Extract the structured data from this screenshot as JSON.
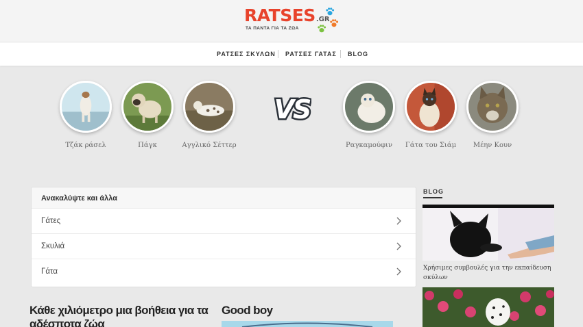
{
  "header": {
    "logo_word": "RATSES",
    "logo_tld": ".GR",
    "tagline": "ΤΑ ΠΑΝΤΑ ΓΙΑ ΤΑ ΖΩΑ",
    "paw_colors": [
      "#2aa6df",
      "#f07a28",
      "#7cc241"
    ]
  },
  "nav": {
    "items": [
      "ΡΑΤΣΕΣ ΣΚΥΛΩΝ",
      "ΡΑΤΣΕΣ ΓΑΤΑΣ",
      "BLOG"
    ]
  },
  "breeds": {
    "dogs": [
      "Τζάκ ράσελ",
      "Πάγκ",
      "Αγγλικό Σέττερ"
    ],
    "vs_label": "VS",
    "cats": [
      "Ραγκαμούφιν",
      "Γάτα του Σιάμ",
      "Μέην Κουν"
    ]
  },
  "discover": {
    "title": "Ανακαλύψτε και άλλα",
    "items": [
      "Γάτες",
      "Σκυλιά",
      "Γάτα"
    ]
  },
  "articles": {
    "help_title": "Κάθε χιλιόμετρο μια βοήθεια για τα αδέσποτα ζώα",
    "good_title": "Good boy"
  },
  "sidebar": {
    "title": "BLOG",
    "posts": [
      {
        "caption": "Χρήσιμες συμβουλές για την εκπαίδευση σκύλων"
      }
    ]
  },
  "colors": {
    "brand": "#e8432c",
    "background": "#e9e9e9"
  }
}
